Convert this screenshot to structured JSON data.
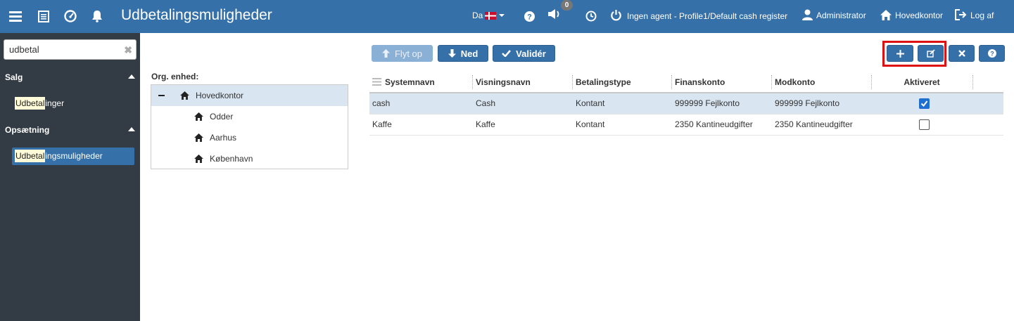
{
  "header": {
    "title": "Udbetalingsmuligheder",
    "language": "Da",
    "notifications_count": "0",
    "agent_label": "Ingen agent - Profile1/Default cash register",
    "user_label": "Administrator",
    "office_label": "Hovedkontor",
    "logout_label": "Log af",
    "icons": [
      "menu-icon",
      "list-icon",
      "dashboard-icon",
      "bell-icon",
      "flag-dk-icon",
      "help-icon",
      "megaphone-icon",
      "clock-icon",
      "power-icon",
      "user-icon",
      "home-icon",
      "logout-icon"
    ]
  },
  "sidebar": {
    "search_value": "udbetal",
    "sections": [
      {
        "label": "Salg",
        "items": [
          {
            "match": "Udbetal",
            "rest": "inger"
          }
        ]
      },
      {
        "label": "Opsætning",
        "items": [
          {
            "match": "Udbetal",
            "rest": "ingsmuligheder"
          }
        ]
      }
    ]
  },
  "org": {
    "label": "Org. enhed:",
    "units": [
      "Hovedkontor",
      "Odder",
      "Aarhus",
      "København"
    ]
  },
  "toolbar": {
    "move_up_label": "Flyt op",
    "down_label": "Ned",
    "validate_label": "Validér",
    "icon_buttons": [
      "add-icon",
      "edit-icon",
      "delete-icon",
      "help-icon"
    ]
  },
  "grid": {
    "columns": [
      "Systemnavn",
      "Visningsnavn",
      "Betalingstype",
      "Finanskonto",
      "Modkonto",
      "Aktiveret"
    ],
    "rows": [
      {
        "systemnavn": "cash",
        "visningsnavn": "Cash",
        "betalingstype": "Kontant",
        "finanskonto": "999999 Fejlkonto",
        "modkonto": "999999 Fejlkonto",
        "aktiveret": true
      },
      {
        "systemnavn": "Kaffe",
        "visningsnavn": "Kaffe",
        "betalingstype": "Kontant",
        "finanskonto": "2350 Kantineudgifter",
        "modkonto": "2350 Kantineudgifter",
        "aktiveret": false
      }
    ]
  },
  "colors": {
    "primary": "#3670a8",
    "sidebar": "#333b44",
    "selected_row": "#d9e5f1",
    "highlight": "#d11111"
  }
}
